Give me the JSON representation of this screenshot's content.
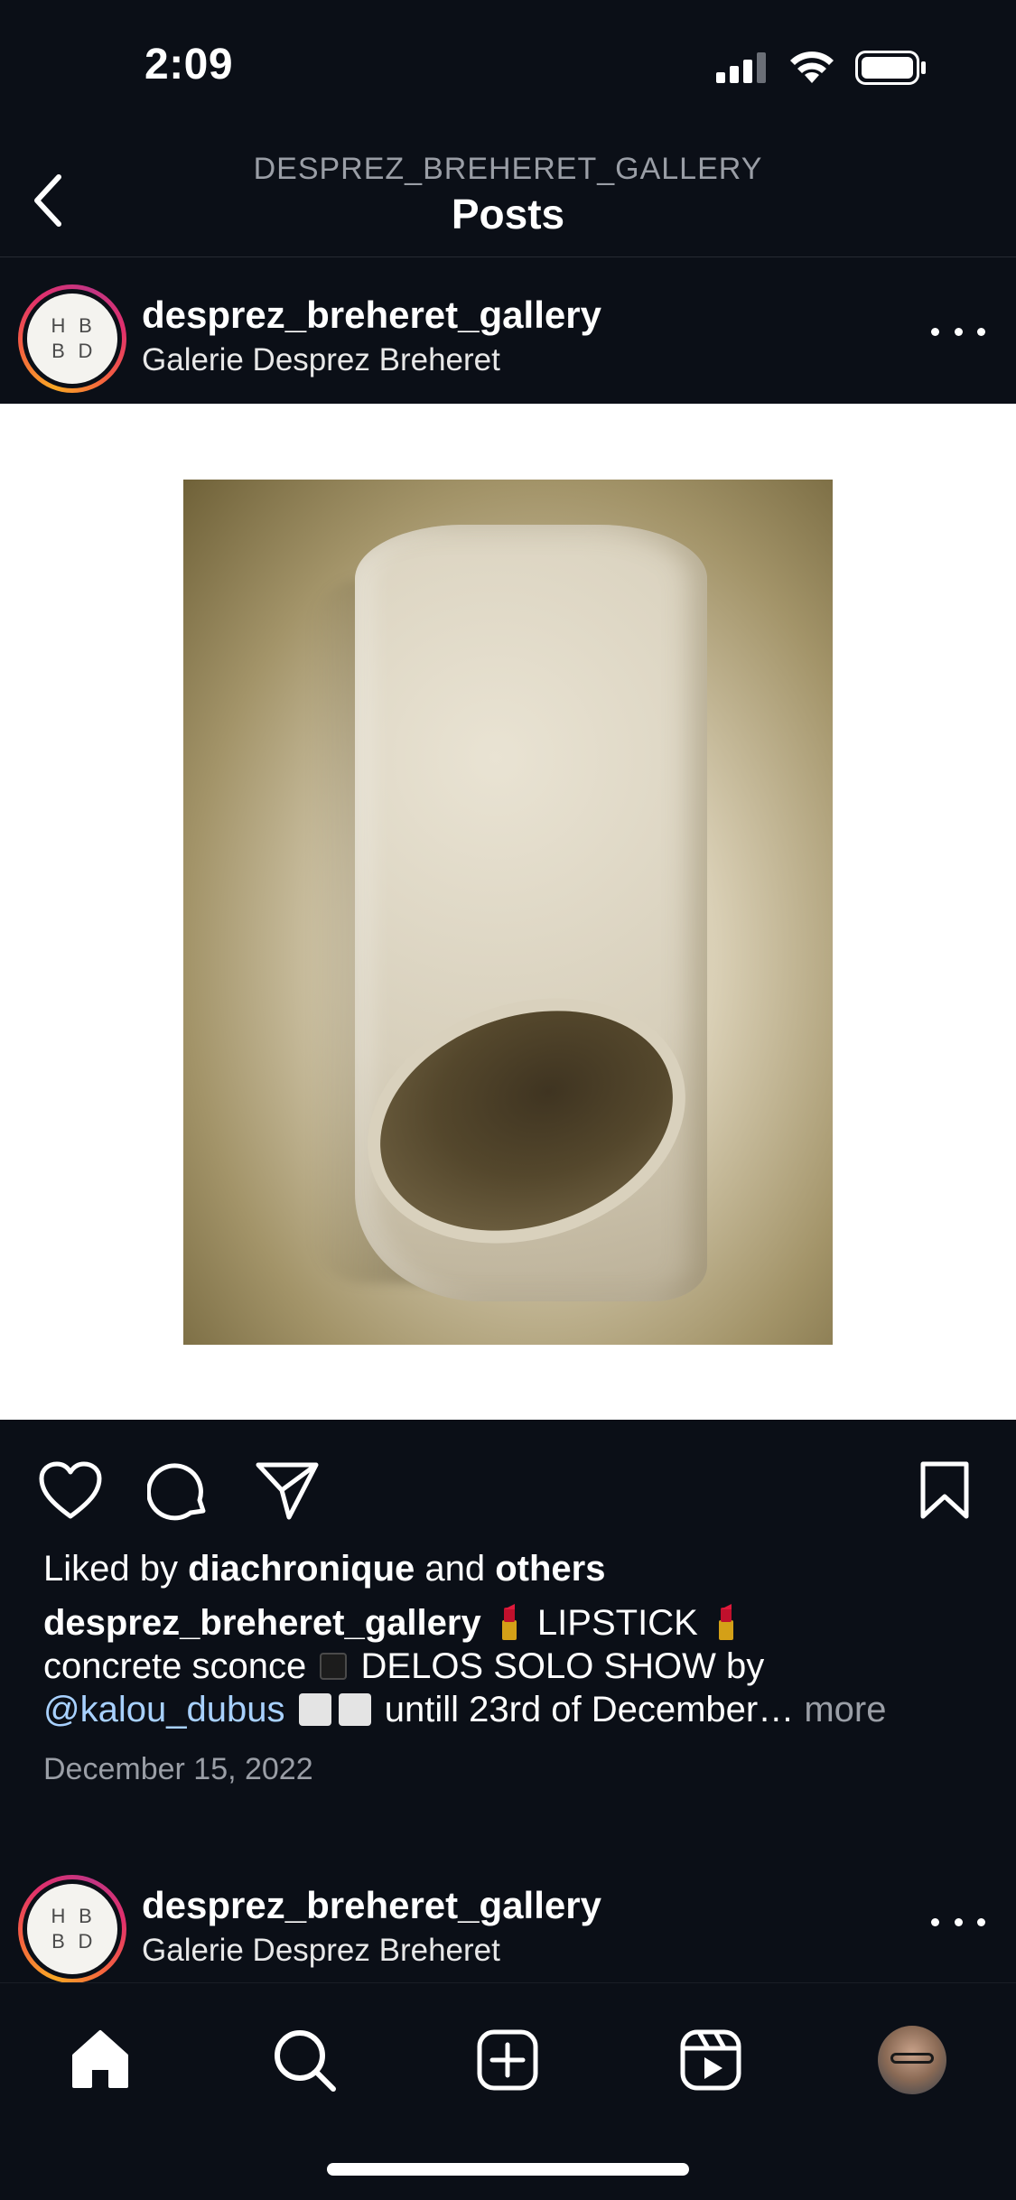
{
  "status_bar": {
    "time": "2:09",
    "icons": [
      "signal-icon",
      "wifi-icon",
      "battery-icon"
    ]
  },
  "header": {
    "subtitle": "DESPREZ_BREHERET_GALLERY",
    "title": "Posts",
    "back_icon": "chevron-left-icon"
  },
  "post": {
    "avatar_letters": [
      "H",
      "B",
      "B",
      "D"
    ],
    "username": "desprez_breheret_gallery",
    "full_name": "Galerie Desprez Breheret",
    "liked_by_prefix": "Liked by ",
    "liked_by_user": "diachronique",
    "liked_by_middle": " and ",
    "liked_by_others": "others",
    "caption": {
      "username": "desprez_breheret_gallery",
      "part1": " LIPSTICK ",
      "part2": "concrete sconce ",
      "part3": " DELOS SOLO SHOW by",
      "mention": "@kalou_dubus",
      "part4": " untill 23rd of December…",
      "more": " more"
    },
    "date": "December 15, 2022"
  },
  "next_post": {
    "avatar_letters": [
      "H",
      "B",
      "B",
      "D"
    ],
    "username": "desprez_breheret_gallery",
    "full_name": "Galerie Desprez Breheret"
  },
  "tab_bar": {
    "tabs": [
      "home-icon",
      "search-icon",
      "create-icon",
      "reels-icon",
      "profile-avatar"
    ]
  },
  "colors": {
    "background": "#0b0f17",
    "mention": "#a8d1ff",
    "muted": "#9a9ea6"
  }
}
